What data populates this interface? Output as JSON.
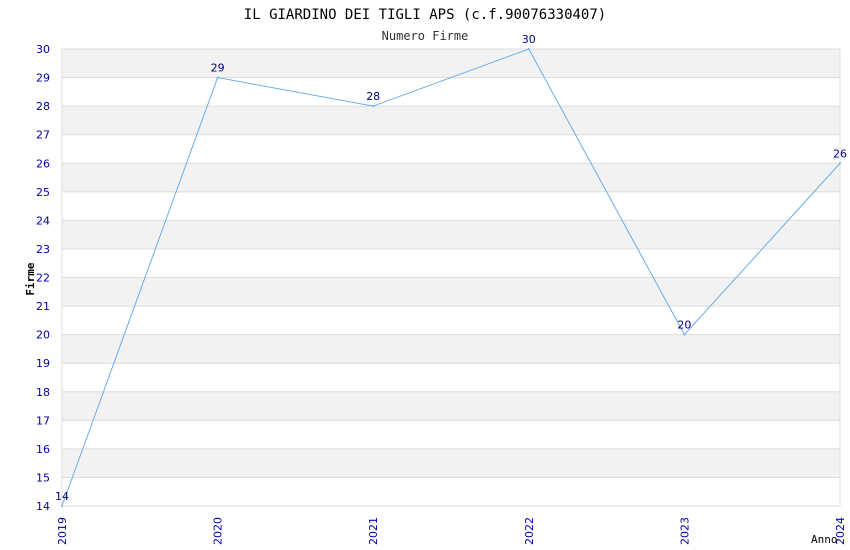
{
  "chart_data": {
    "type": "line",
    "title": "IL GIARDINO DEI TIGLI APS (c.f.90076330407)",
    "subtitle": "Numero Firme",
    "xlabel": "Anno",
    "ylabel": "Firme",
    "categories": [
      "2019",
      "2020",
      "2021",
      "2022",
      "2023",
      "2024"
    ],
    "series": [
      {
        "values": [
          14,
          29,
          28,
          30,
          20,
          26
        ]
      }
    ],
    "ylim": [
      14,
      30
    ],
    "yticks": [
      "14",
      "15",
      "16",
      "17",
      "18",
      "19",
      "20",
      "21",
      "22",
      "23",
      "24",
      "25",
      "26",
      "27",
      "28",
      "29",
      "30"
    ],
    "grid": true,
    "colors": {
      "line": "#6aaeea",
      "tick_label": "#0000aa",
      "data_label": "#000080",
      "band_light": "#f2f2f2",
      "band_white": "#ffffff",
      "grid": "#dcdcdc",
      "title": "#000000",
      "subtitle": "#333333"
    }
  }
}
